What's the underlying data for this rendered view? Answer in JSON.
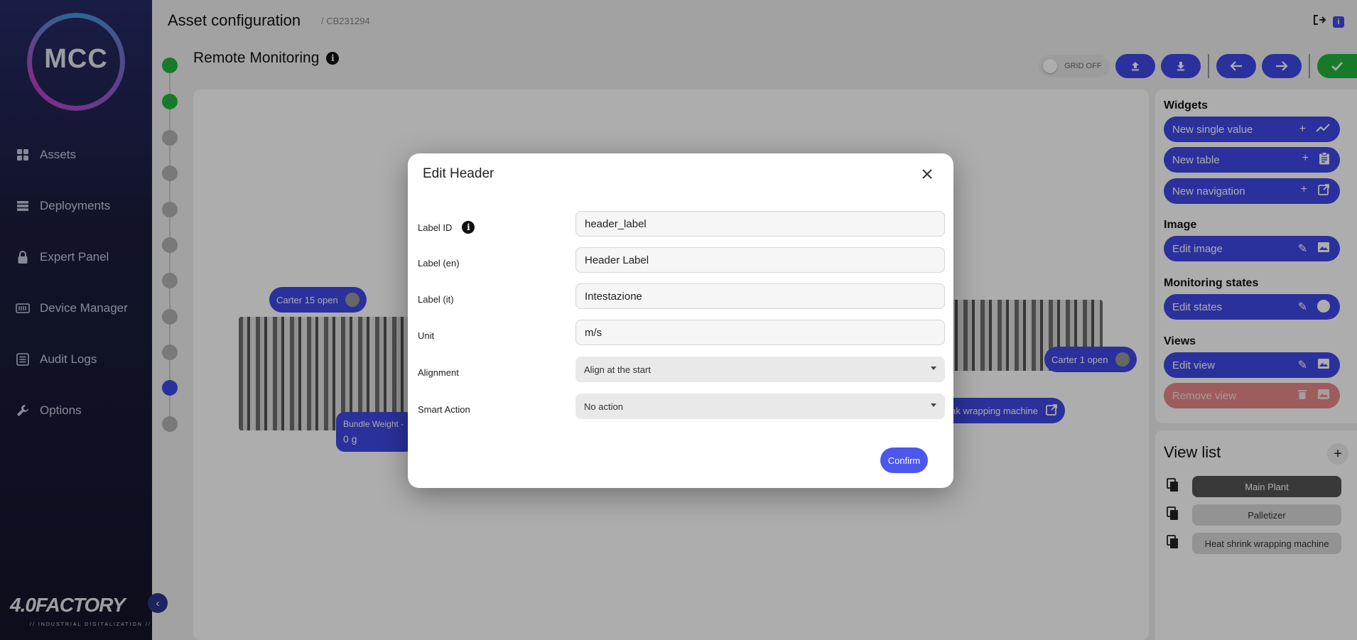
{
  "app": {
    "logo_text": "MCC",
    "brand": "4.0FACTORY",
    "brand_sub": "// INDUSTRIAL DIGITALIZATION //"
  },
  "sidebar": {
    "items": [
      {
        "label": "Assets",
        "icon": "grid-icon"
      },
      {
        "label": "Deployments",
        "icon": "layers-icon"
      },
      {
        "label": "Expert Panel",
        "icon": "lock-icon"
      },
      {
        "label": "Device Manager",
        "icon": "device-icon"
      },
      {
        "label": "Audit Logs",
        "icon": "list-icon"
      },
      {
        "label": "Options",
        "icon": "wrench-icon"
      }
    ]
  },
  "header": {
    "title": "Asset configuration",
    "code": "/ CB231294"
  },
  "section": {
    "title": "Remote Monitoring"
  },
  "toolbar": {
    "grid_label": "GRID OFF"
  },
  "canvas": {
    "chips": {
      "carter15": "Carter 15 open",
      "carter1": "Carter 1 open",
      "bundle_weight": "Bundle Weight - ",
      "bundle_value": "0 g",
      "heat_shrink": "t shrink wrapping machine"
    }
  },
  "right_panel": {
    "widgets_title": "Widgets",
    "new_single_value": "New single value",
    "new_table": "New table",
    "new_navigation": "New navigation",
    "image_title": "Image",
    "edit_image": "Edit image",
    "monitoring_title": "Monitoring states",
    "edit_states": "Edit states",
    "views_title": "Views",
    "edit_view": "Edit view",
    "remove_view": "Remove view"
  },
  "view_list": {
    "title": "View list",
    "items": [
      "Main Plant",
      "Palletizer",
      "Heat shrink wrapping machine"
    ]
  },
  "modal": {
    "title": "Edit Header",
    "fields": {
      "label_id": {
        "label": "Label ID",
        "value": "header_label"
      },
      "label_en": {
        "label": "Label (en)",
        "value": "Header Label"
      },
      "label_it": {
        "label": "Label (it)",
        "value": "Intestazione"
      },
      "unit": {
        "label": "Unit",
        "value": "m/s"
      },
      "alignment": {
        "label": "Alignment",
        "value": "Align at the start"
      },
      "smart_action": {
        "label": "Smart Action",
        "value": "No action"
      }
    },
    "confirm": "Confirm"
  },
  "colors": {
    "primary": "#3e49e6",
    "success": "#22b43b",
    "danger_disabled": "#e88a8a",
    "sidebar_top": "#262a66",
    "sidebar_bottom": "#14152a"
  }
}
